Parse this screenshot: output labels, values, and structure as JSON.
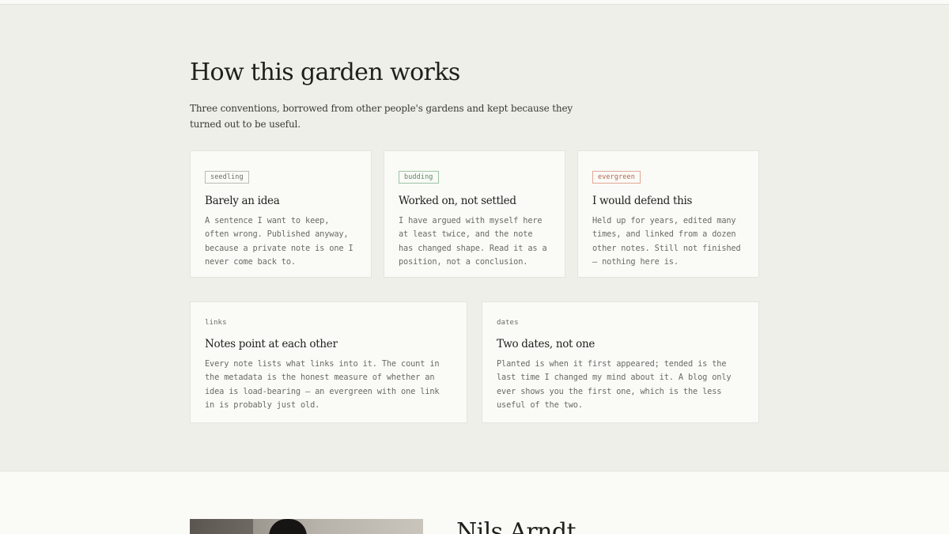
{
  "how_section": {
    "title": "How this garden works",
    "intro": "Three conventions, borrowed from other people's gardens and kept because they turned out to be useful."
  },
  "stages": [
    {
      "badge": "seedling",
      "title": "Barely an idea",
      "body": "A sentence I want to keep, often wrong. Published anyway, because a private note is one I never come back to.",
      "badge_color": "#6b6e68"
    },
    {
      "badge": "budding",
      "title": "Worked on, not settled",
      "body": "I have argued with myself here at least twice, and the note has changed shape. Read it as a position, not a conclusion.",
      "badge_color": "#5a8a62"
    },
    {
      "badge": "evergreen",
      "title": "I would defend this",
      "body": "Held up for years, edited many times, and linked from a dozen other notes. Still not finished — nothing here is.",
      "badge_color": "#b5654a"
    }
  ],
  "conventions": [
    {
      "kicker": "links",
      "title": "Notes point at each other",
      "body": "Every note lists what links into it. The count in the metadata is the honest measure of whether an idea is load-bearing — an evergreen with one link in is probably just old."
    },
    {
      "kicker": "dates",
      "title": "Two dates, not one",
      "body": "Planted is when it first appeared; tended is the last time I changed my mind about it. A blog only ever shows you the first one, which is the less useful of the two."
    }
  ],
  "about": {
    "name": "Nils Arndt"
  }
}
